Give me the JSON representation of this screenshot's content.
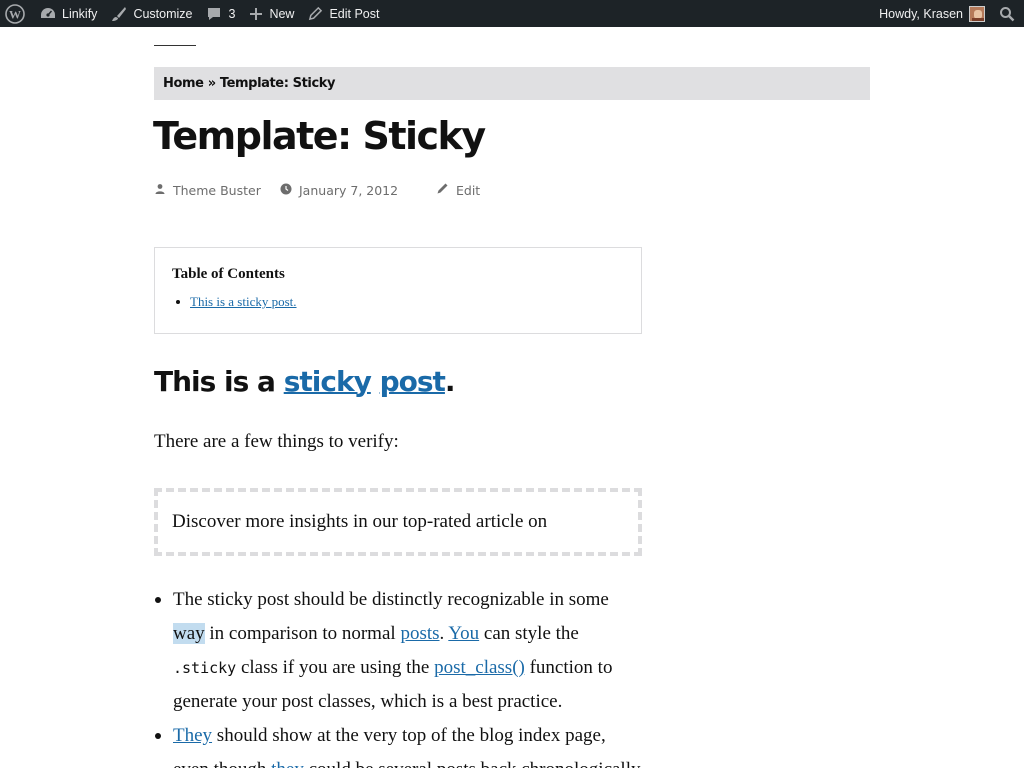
{
  "adminbar": {
    "site_name": "Linkify",
    "customize": "Customize",
    "comments_count": "3",
    "new": "New",
    "edit_post": "Edit Post",
    "howdy": "Howdy, Krasen"
  },
  "breadcrumb": {
    "home": "Home",
    "sep": "»",
    "current": "Template: Sticky"
  },
  "post": {
    "title": "Template: Sticky",
    "author": "Theme Buster",
    "date": "January 7, 2012",
    "edit": "Edit"
  },
  "toc": {
    "title": "Table of Contents",
    "items": [
      "This is a sticky post."
    ]
  },
  "content": {
    "heading_prefix": "This is a ",
    "heading_link1": "sticky",
    "heading_space": " ",
    "heading_link2": "post",
    "heading_suffix": ".",
    "intro": "There are a few things to verify:",
    "promo": "Discover more insights in our top-rated article on",
    "bullet1": {
      "t1": "The sticky post should be distinctly recognizable in some ",
      "highlight": "way",
      "t2": " in comparison to normal ",
      "link1": "posts",
      "t3": ". ",
      "link2": "You",
      "t4": " can style the ",
      "code": ".sticky",
      "t5": " class if you are using the ",
      "link3": "post_class()",
      "t6": " function to generate your post classes, which is a best practice."
    },
    "bullet2": {
      "link1": "They",
      "t1": " should show at the very top of the blog index page, even though ",
      "link2": "they",
      "t2": " could be several posts back chronologically."
    }
  }
}
